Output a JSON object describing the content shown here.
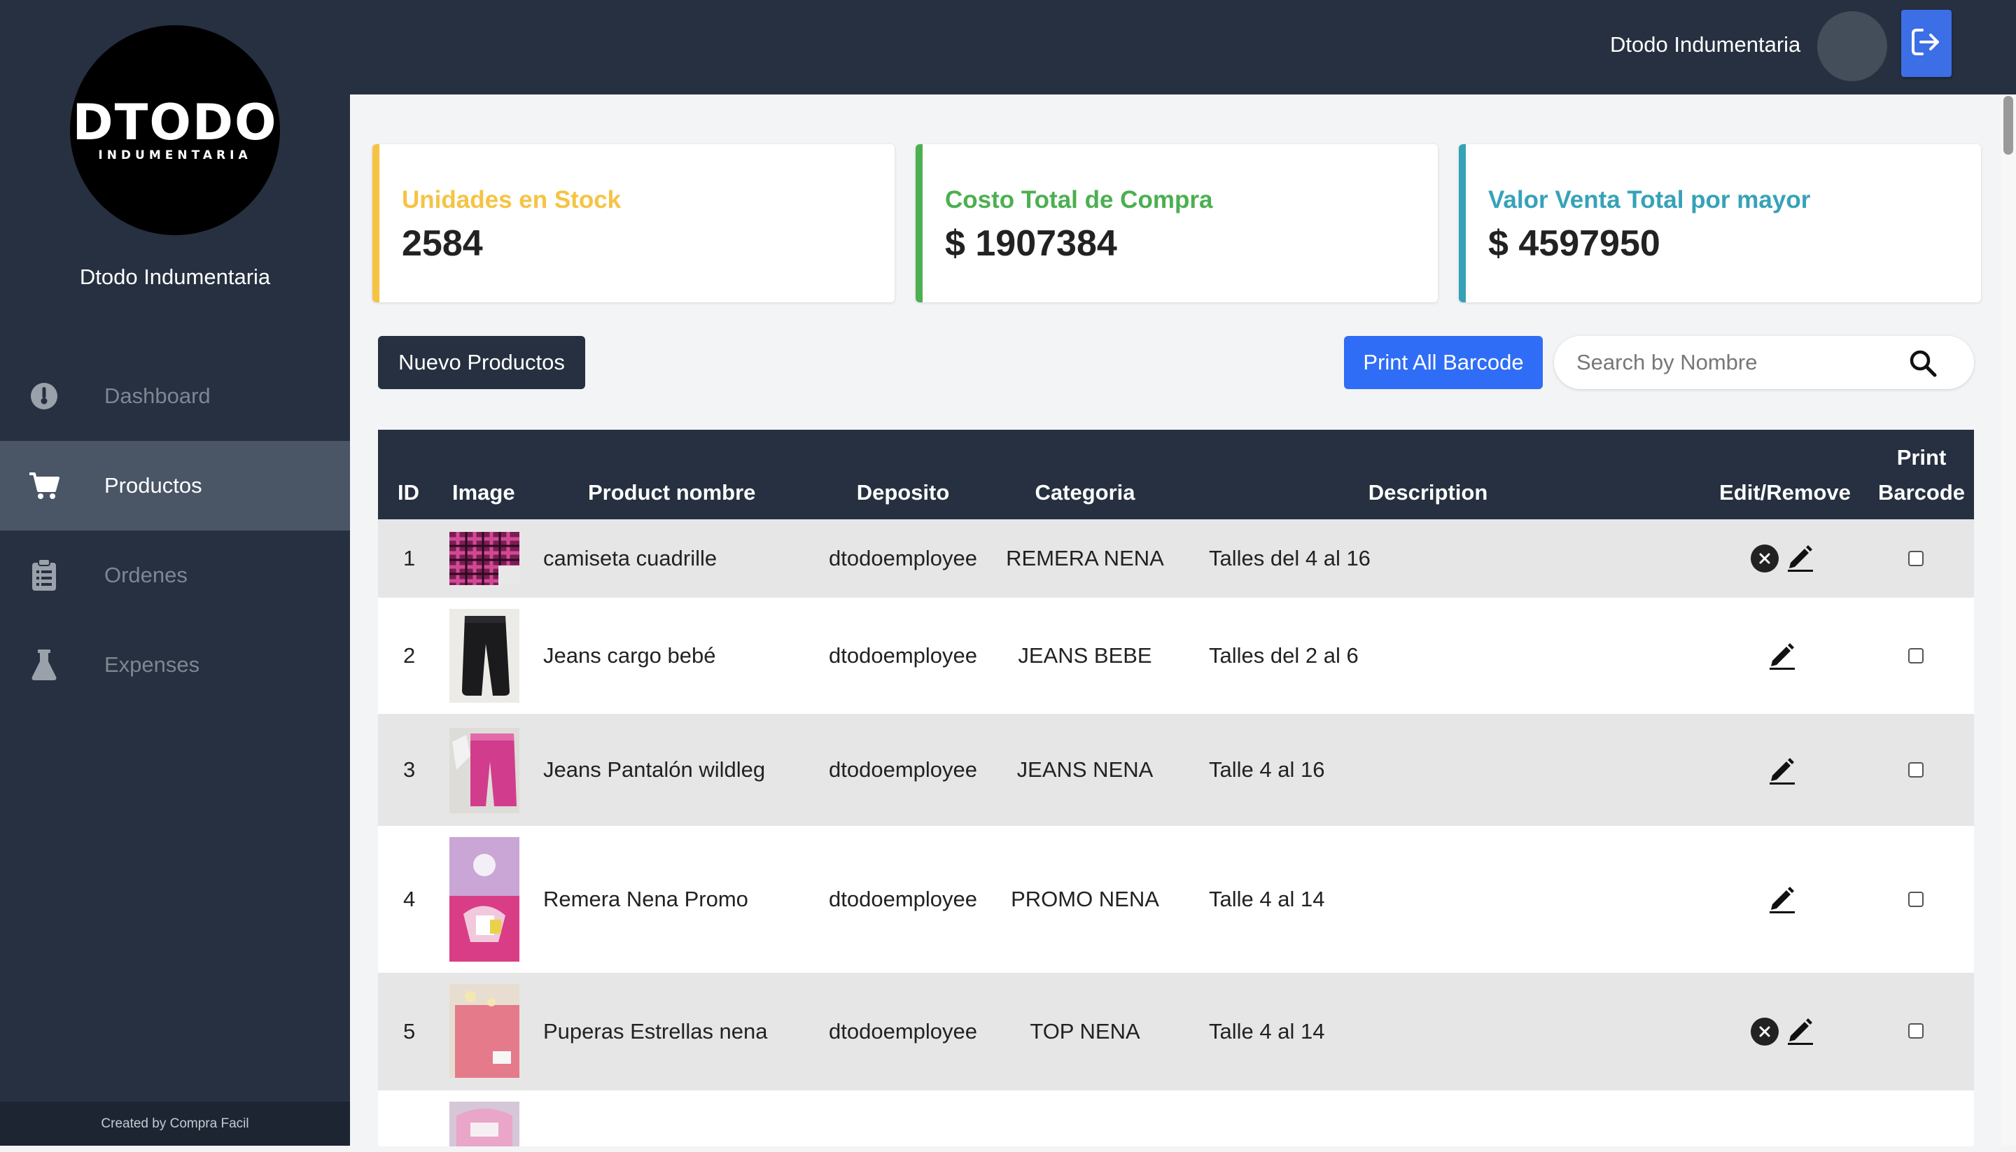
{
  "app": {
    "brand_logo_text": "DTODO",
    "brand_logo_sub": "INDUMENTARIA",
    "store_name": "Dtodo Indumentaria",
    "footer": "Created by Compra Facil"
  },
  "sidebar": {
    "items": [
      {
        "label": "Dashboard",
        "icon": "thermometer-icon",
        "active": false
      },
      {
        "label": "Productos",
        "icon": "cart-icon",
        "active": true
      },
      {
        "label": "Ordenes",
        "icon": "clipboard-icon",
        "active": false
      },
      {
        "label": "Expenses",
        "icon": "flask-icon",
        "active": false
      }
    ]
  },
  "header": {
    "user_name": "Dtodo Indumentaria",
    "logout_icon": "logout-icon"
  },
  "stats": [
    {
      "label": "Unidades en Stock",
      "value": "2584",
      "color": "#f6c343"
    },
    {
      "label": "Costo Total de Compra",
      "value": "$ 1907384",
      "color": "#4caf50"
    },
    {
      "label": "Valor Venta Total por mayor",
      "value": "$ 4597950",
      "color": "#36a2b8"
    }
  ],
  "toolbar": {
    "new_button": "Nuevo Productos",
    "print_all_button": "Print All Barcode",
    "search_placeholder": "Search by Nombre"
  },
  "table": {
    "headers": {
      "id": "ID",
      "image": "Image",
      "name": "Product nombre",
      "deposito": "Deposito",
      "categoria": "Categoria",
      "description": "Description",
      "edit_remove": "Edit/Remove",
      "print_1": "Print",
      "print_2": "Barcode"
    },
    "rows": [
      {
        "id": "1",
        "name": "camiseta cuadrille",
        "deposito": "dtodoemployee",
        "categoria": "REMERA NENA",
        "description": "Talles del 4 al 16",
        "removable": true
      },
      {
        "id": "2",
        "name": "Jeans cargo bebé",
        "deposito": "dtodoemployee",
        "categoria": "JEANS BEBE",
        "description": "Talles del 2 al 6",
        "removable": false
      },
      {
        "id": "3",
        "name": "Jeans Pantalón wildleg",
        "deposito": "dtodoemployee",
        "categoria": "JEANS NENA",
        "description": "Talle 4 al 16",
        "removable": false
      },
      {
        "id": "4",
        "name": "Remera Nena Promo",
        "deposito": "dtodoemployee",
        "categoria": "PROMO NENA",
        "description": "Talle 4 al 14",
        "removable": false
      },
      {
        "id": "5",
        "name": "Puperas Estrellas nena",
        "deposito": "dtodoemployee",
        "categoria": "TOP NENA",
        "description": "Talle 4 al 14",
        "removable": true
      }
    ]
  }
}
